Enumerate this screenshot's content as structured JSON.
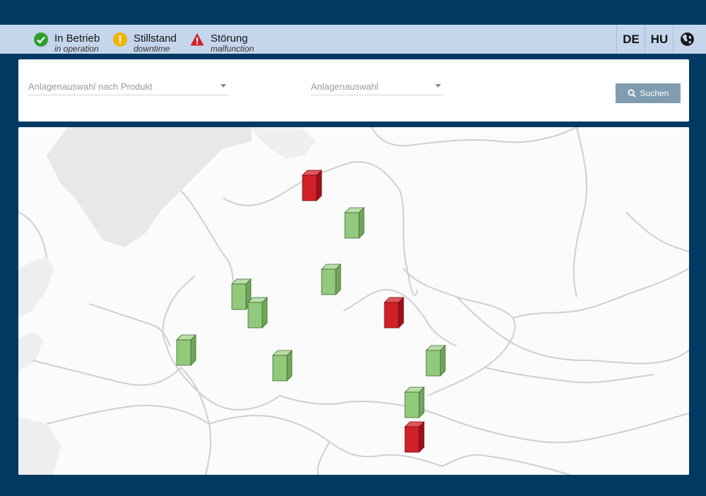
{
  "legend": {
    "operation": {
      "label": "In Betrieb",
      "sub": "in operation",
      "color": "#2e9e2e",
      "icon": "check-circle-icon"
    },
    "downtime": {
      "label": "Stillstand",
      "sub": "downtime",
      "color": "#f2b300",
      "icon": "exclamation-circle-icon"
    },
    "malfunction": {
      "label": "Störung",
      "sub": "malfunction",
      "color": "#d0202a",
      "icon": "warning-triangle-icon"
    }
  },
  "languages": [
    "DE",
    "HU"
  ],
  "filters": {
    "product_select": "Anlagenauswahl nach Produkt",
    "plant_select": "Anlagenauswahl",
    "search_button": "Suchen"
  },
  "map": {
    "markers": [
      {
        "status": "malfunction"
      },
      {
        "status": "operation"
      },
      {
        "status": "operation"
      },
      {
        "status": "operation"
      },
      {
        "status": "operation"
      },
      {
        "status": "malfunction"
      },
      {
        "status": "operation"
      },
      {
        "status": "operation"
      },
      {
        "status": "operation"
      },
      {
        "status": "operation"
      },
      {
        "status": "malfunction"
      }
    ]
  }
}
